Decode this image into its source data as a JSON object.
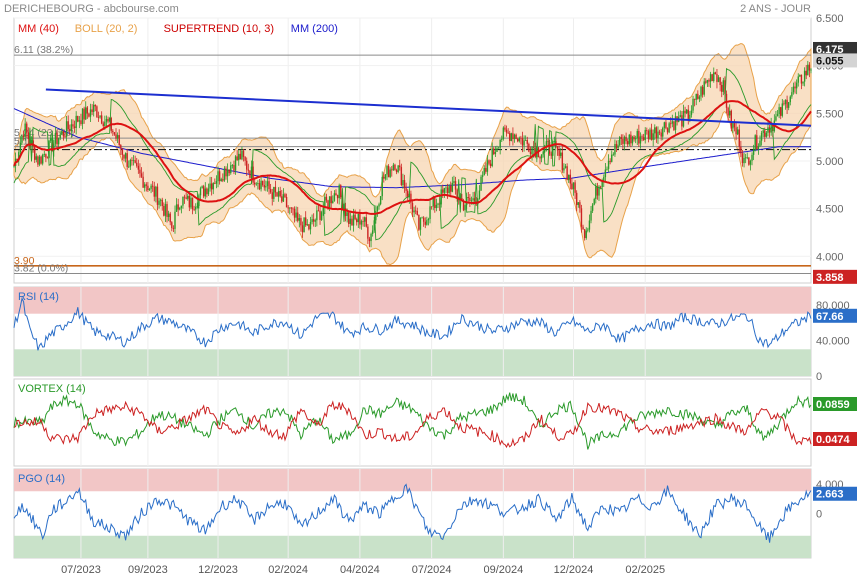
{
  "header": {
    "title": "DERICHEBOURG - abcbourse.com",
    "period": "2 ANS - JOUR"
  },
  "colors": {
    "mm40": "#dd1111",
    "boll": "#e8a24a",
    "boll_fill": "#f7d3ac",
    "supertrend": "#cc0000",
    "mm200": "#1a1acc",
    "up_candle": "#2a9a2a",
    "down_candle": "#cc2222",
    "level_line": "#8a8a8a",
    "support_orange": "#c8661a",
    "trendline": "#1c2fd0",
    "rsi": "#2a6ec8",
    "pgo": "#2a6ec8",
    "vortex_plus": "#2a9a2a",
    "vortex_minus": "#cc2222",
    "overbought_zone": "#f2c6c6",
    "oversold_zone": "#c9e2c9",
    "last_price_badge": "#333333",
    "close_badge": "#d4d4d4",
    "low_badge": "#cc2222",
    "rsi_badge": "#2a6ec8",
    "vortex_plus_badge": "#2a9a2a",
    "vortex_minus_badge": "#cc2222",
    "pgo_badge": "#2a6ec8"
  },
  "chart_data": [
    {
      "panel": "price",
      "type": "candlestick",
      "legend": [
        {
          "label": "MM (40)",
          "color": "#dd1111"
        },
        {
          "label": "BOLL (20, 2)",
          "color": "#e8a24a"
        },
        {
          "label": "SUPERTREND (10, 3)",
          "color": "#cc0000"
        },
        {
          "label": "MM (200)",
          "color": "#1a1acc"
        }
      ],
      "ylim": [
        3.72,
        6.5
      ],
      "yticks": [
        4.0,
        4.5,
        5.0,
        5.5,
        6.0,
        6.5
      ],
      "ytick_labels": [
        "4.000",
        "4.500",
        "5.000",
        "5.500",
        "6.000",
        "6.500"
      ],
      "x_range": [
        0,
        500
      ],
      "xticks": [
        {
          "pos": 42,
          "label": "07/2023"
        },
        {
          "pos": 84,
          "label": "09/2023"
        },
        {
          "pos": 128,
          "label": "12/2023"
        },
        {
          "pos": 172,
          "label": "02/2024"
        },
        {
          "pos": 217,
          "label": "04/2024"
        },
        {
          "pos": 262,
          "label": "07/2024"
        },
        {
          "pos": 307,
          "label": "09/2024"
        },
        {
          "pos": 351,
          "label": "12/2024"
        },
        {
          "pos": 396,
          "label": "02/2025"
        }
      ],
      "price_waypoints": [
        [
          0,
          4.95
        ],
        [
          5,
          5.35
        ],
        [
          12,
          5.0
        ],
        [
          22,
          5.25
        ],
        [
          32,
          5.45
        ],
        [
          40,
          5.55
        ],
        [
          48,
          5.35
        ],
        [
          56,
          5.0
        ],
        [
          64,
          4.8
        ],
        [
          72,
          4.6
        ],
        [
          78,
          4.3
        ],
        [
          82,
          4.6
        ],
        [
          88,
          4.55
        ],
        [
          96,
          4.75
        ],
        [
          104,
          4.9
        ],
        [
          112,
          5.05
        ],
        [
          118,
          4.85
        ],
        [
          126,
          4.7
        ],
        [
          134,
          4.55
        ],
        [
          140,
          4.35
        ],
        [
          146,
          4.3
        ],
        [
          154,
          4.55
        ],
        [
          160,
          4.7
        ],
        [
          166,
          4.35
        ],
        [
          172,
          4.4
        ],
        [
          176,
          4.2
        ],
        [
          182,
          4.8
        ],
        [
          188,
          5.0
        ],
        [
          194,
          4.7
        ],
        [
          200,
          4.3
        ],
        [
          206,
          4.5
        ],
        [
          212,
          4.65
        ],
        [
          216,
          4.75
        ],
        [
          222,
          4.55
        ],
        [
          228,
          4.6
        ],
        [
          234,
          4.95
        ],
        [
          240,
          5.25
        ],
        [
          246,
          5.3
        ],
        [
          252,
          5.2
        ],
        [
          260,
          5.1
        ],
        [
          266,
          5.15
        ],
        [
          272,
          4.95
        ],
        [
          278,
          4.6
        ],
        [
          282,
          4.25
        ],
        [
          288,
          4.7
        ],
        [
          294,
          5.05
        ],
        [
          300,
          5.2
        ],
        [
          308,
          5.25
        ],
        [
          316,
          5.3
        ],
        [
          324,
          5.4
        ],
        [
          332,
          5.45
        ],
        [
          340,
          5.75
        ],
        [
          346,
          5.95
        ],
        [
          350,
          5.8
        ],
        [
          354,
          5.4
        ],
        [
          358,
          5.25
        ],
        [
          361,
          4.95
        ],
        [
          364,
          5.1
        ],
        [
          368,
          5.25
        ],
        [
          372,
          5.35
        ],
        [
          376,
          5.42
        ],
        [
          380,
          5.55
        ],
        [
          383,
          5.7
        ],
        [
          386,
          5.75
        ],
        [
          390,
          5.9
        ],
        [
          393,
          5.98
        ]
      ],
      "price_path_x_scale": 1.27,
      "mm200_waypoints": [
        [
          0,
          5.55
        ],
        [
          40,
          5.25
        ],
        [
          80,
          5.08
        ],
        [
          120,
          4.95
        ],
        [
          160,
          4.82
        ],
        [
          200,
          4.73
        ],
        [
          240,
          4.72
        ],
        [
          280,
          4.75
        ],
        [
          320,
          4.8
        ],
        [
          350,
          4.82
        ],
        [
          380,
          4.9
        ],
        [
          420,
          5.0
        ],
        [
          460,
          5.1
        ],
        [
          480,
          5.15
        ],
        [
          500,
          5.15
        ]
      ],
      "level_lines": [
        {
          "label": "6.11 (38.2%)",
          "value": 6.11
        },
        {
          "label": "5.24 (23.6%)",
          "value": 5.24
        },
        {
          "label": "5.15",
          "value": 5.15
        },
        {
          "label": "3.90",
          "value": 3.9
        },
        {
          "label": "3.82 (0.0%)",
          "value": 3.82
        }
      ],
      "trendline": {
        "from": [
          20,
          5.75
        ],
        "to": [
          500,
          5.37
        ]
      },
      "dash_dot_level": 5.12,
      "support_level": 3.9,
      "badges": [
        {
          "label": "6.175",
          "value": 6.175
        },
        {
          "label": "6.055",
          "value": 6.055
        },
        {
          "label": "3.858",
          "value": 3.858
        }
      ]
    },
    {
      "panel": "rsi",
      "type": "line",
      "legend": [
        {
          "label": "RSI (14)",
          "color": "#2a6ec8"
        }
      ],
      "ylim": [
        0,
        100
      ],
      "yticks": [
        0,
        40,
        80
      ],
      "ytick_labels": [
        "0",
        "40.000",
        "80.000"
      ],
      "overbought": 70,
      "oversold": 30,
      "last_value": 67.66,
      "badge": "67.66",
      "waypoints": [
        [
          0,
          55
        ],
        [
          5,
          85
        ],
        [
          10,
          50
        ],
        [
          16,
          30
        ],
        [
          22,
          45
        ],
        [
          30,
          55
        ],
        [
          40,
          72
        ],
        [
          50,
          50
        ],
        [
          60,
          45
        ],
        [
          70,
          38
        ],
        [
          80,
          55
        ],
        [
          90,
          65
        ],
        [
          100,
          60
        ],
        [
          110,
          50
        ],
        [
          120,
          38
        ],
        [
          130,
          55
        ],
        [
          140,
          60
        ],
        [
          150,
          48
        ],
        [
          160,
          58
        ],
        [
          170,
          62
        ],
        [
          180,
          45
        ],
        [
          190,
          66
        ],
        [
          200,
          68
        ],
        [
          210,
          48
        ],
        [
          220,
          55
        ],
        [
          230,
          52
        ],
        [
          240,
          62
        ],
        [
          250,
          58
        ],
        [
          260,
          48
        ],
        [
          270,
          45
        ],
        [
          280,
          65
        ],
        [
          290,
          58
        ],
        [
          300,
          50
        ],
        [
          310,
          55
        ],
        [
          320,
          62
        ],
        [
          330,
          60
        ],
        [
          340,
          48
        ],
        [
          350,
          62
        ],
        [
          360,
          50
        ],
        [
          370,
          58
        ],
        [
          380,
          40
        ],
        [
          390,
          52
        ],
        [
          400,
          60
        ],
        [
          410,
          55
        ],
        [
          420,
          66
        ],
        [
          430,
          62
        ],
        [
          440,
          58
        ],
        [
          450,
          64
        ],
        [
          460,
          68
        ],
        [
          468,
          40
        ],
        [
          474,
          35
        ],
        [
          480,
          45
        ],
        [
          486,
          55
        ],
        [
          492,
          60
        ],
        [
          500,
          68
        ]
      ]
    },
    {
      "panel": "vortex",
      "type": "line",
      "legend": [
        {
          "label": "VORTEX (14)",
          "color": "#2a9a2a"
        }
      ],
      "ylim": [
        -1,
        1
      ],
      "last_value_plus": 0.0859,
      "last_value_minus": 0.0474,
      "badge_plus": "0.0859",
      "badge_minus": "0.0474",
      "plus_waypoints": [
        [
          0,
          0
        ],
        [
          18,
          0
        ],
        [
          22,
          0.3
        ],
        [
          30,
          0.5
        ],
        [
          40,
          0.45
        ],
        [
          50,
          -0.2
        ],
        [
          60,
          -0.4
        ],
        [
          70,
          -0.45
        ],
        [
          80,
          -0.2
        ],
        [
          90,
          0.2
        ],
        [
          100,
          0.1
        ],
        [
          110,
          -0.1
        ],
        [
          120,
          -0.3
        ],
        [
          130,
          0.1
        ],
        [
          140,
          0.3
        ],
        [
          150,
          -0.1
        ],
        [
          160,
          0.2
        ],
        [
          170,
          0.3
        ],
        [
          180,
          -0.3
        ],
        [
          190,
          0.1
        ],
        [
          200,
          -0.4
        ],
        [
          210,
          -0.3
        ],
        [
          220,
          0.3
        ],
        [
          230,
          0.2
        ],
        [
          240,
          0.45
        ],
        [
          250,
          0.3
        ],
        [
          260,
          -0.1
        ],
        [
          270,
          -0.3
        ],
        [
          280,
          0.1
        ],
        [
          290,
          0.2
        ],
        [
          300,
          0.3
        ],
        [
          310,
          0.6
        ],
        [
          320,
          0.5
        ],
        [
          330,
          -0.1
        ],
        [
          340,
          0.3
        ],
        [
          350,
          0.4
        ],
        [
          360,
          -0.5
        ],
        [
          370,
          -0.3
        ],
        [
          380,
          -0.2
        ],
        [
          390,
          0.1
        ],
        [
          400,
          0.2
        ],
        [
          410,
          0.3
        ],
        [
          420,
          0.2
        ],
        [
          430,
          0.1
        ],
        [
          440,
          -0.1
        ],
        [
          450,
          0.2
        ],
        [
          460,
          0.3
        ],
        [
          470,
          -0.4
        ],
        [
          480,
          0.0
        ],
        [
          490,
          0.5
        ],
        [
          500,
          0.45
        ]
      ],
      "minus_waypoints": [
        [
          0,
          0
        ],
        [
          18,
          0
        ],
        [
          22,
          -0.3
        ],
        [
          30,
          -0.4
        ],
        [
          40,
          -0.35
        ],
        [
          50,
          0.2
        ],
        [
          60,
          0.3
        ],
        [
          70,
          0.35
        ],
        [
          80,
          0.2
        ],
        [
          90,
          -0.2
        ],
        [
          100,
          -0.1
        ],
        [
          110,
          0.1
        ],
        [
          120,
          0.3
        ],
        [
          130,
          -0.1
        ],
        [
          140,
          -0.3
        ],
        [
          150,
          0.1
        ],
        [
          160,
          -0.2
        ],
        [
          170,
          -0.3
        ],
        [
          180,
          0.3
        ],
        [
          190,
          -0.1
        ],
        [
          200,
          0.4
        ],
        [
          210,
          0.3
        ],
        [
          220,
          -0.3
        ],
        [
          230,
          -0.2
        ],
        [
          240,
          -0.4
        ],
        [
          250,
          -0.3
        ],
        [
          260,
          0.1
        ],
        [
          270,
          0.3
        ],
        [
          280,
          -0.1
        ],
        [
          290,
          -0.2
        ],
        [
          300,
          -0.3
        ],
        [
          310,
          -0.5
        ],
        [
          320,
          -0.4
        ],
        [
          330,
          0.1
        ],
        [
          340,
          -0.3
        ],
        [
          350,
          -0.3
        ],
        [
          360,
          0.4
        ],
        [
          370,
          0.3
        ],
        [
          380,
          0.2
        ],
        [
          390,
          -0.1
        ],
        [
          400,
          -0.2
        ],
        [
          410,
          -0.2
        ],
        [
          420,
          -0.1
        ],
        [
          430,
          0.0
        ],
        [
          440,
          0.1
        ],
        [
          450,
          -0.1
        ],
        [
          460,
          -0.2
        ],
        [
          470,
          0.3
        ],
        [
          480,
          0.1
        ],
        [
          490,
          -0.4
        ],
        [
          500,
          -0.45
        ]
      ]
    },
    {
      "panel": "pgo",
      "type": "line",
      "legend": [
        {
          "label": "PGO (14)",
          "color": "#2a6ec8"
        }
      ],
      "ylim": [
        -6,
        6
      ],
      "yticks": [
        0,
        4
      ],
      "ytick_labels": [
        "0",
        "4.000"
      ],
      "overbought": 3,
      "oversold": -3,
      "last_value": 2.663,
      "badge": "2.663",
      "waypoints": [
        [
          0,
          0
        ],
        [
          6,
          1
        ],
        [
          12,
          -1
        ],
        [
          18,
          -3
        ],
        [
          24,
          0.5
        ],
        [
          32,
          1.5
        ],
        [
          40,
          3.2
        ],
        [
          50,
          -1
        ],
        [
          60,
          -2
        ],
        [
          70,
          -3
        ],
        [
          80,
          0
        ],
        [
          90,
          2
        ],
        [
          100,
          1
        ],
        [
          110,
          -1
        ],
        [
          120,
          -2.5
        ],
        [
          130,
          1
        ],
        [
          140,
          2
        ],
        [
          150,
          -1
        ],
        [
          160,
          1
        ],
        [
          170,
          1.5
        ],
        [
          180,
          -2
        ],
        [
          190,
          0
        ],
        [
          200,
          2
        ],
        [
          210,
          -1
        ],
        [
          220,
          1
        ],
        [
          230,
          0
        ],
        [
          240,
          2.5
        ],
        [
          246,
          3.5
        ],
        [
          252,
          1
        ],
        [
          260,
          -2.5
        ],
        [
          270,
          -3
        ],
        [
          280,
          1
        ],
        [
          290,
          2
        ],
        [
          300,
          1
        ],
        [
          310,
          0
        ],
        [
          320,
          1
        ],
        [
          330,
          2
        ],
        [
          340,
          -1
        ],
        [
          350,
          2
        ],
        [
          360,
          -2
        ],
        [
          370,
          1
        ],
        [
          380,
          0
        ],
        [
          390,
          2
        ],
        [
          400,
          1
        ],
        [
          410,
          3
        ],
        [
          420,
          0
        ],
        [
          430,
          -3
        ],
        [
          440,
          1
        ],
        [
          450,
          2
        ],
        [
          460,
          1
        ],
        [
          468,
          -2
        ],
        [
          474,
          -3.5
        ],
        [
          480,
          -1
        ],
        [
          488,
          1
        ],
        [
          494,
          2
        ],
        [
          500,
          2.7
        ]
      ]
    }
  ]
}
